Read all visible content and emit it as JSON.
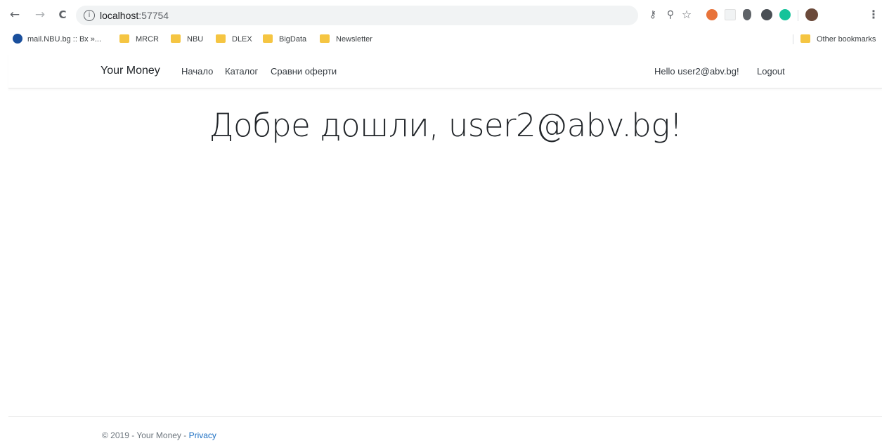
{
  "browser": {
    "url_host": "localhost",
    "url_port": ":57754",
    "back_icon": "←",
    "forward_icon": "→",
    "reload_icon": "C",
    "info_icon": "i",
    "key_icon": "⚷",
    "zoom_icon": "⚲",
    "star_icon": "☆",
    "menu_icon": "⋮",
    "colors": {
      "ext_red": "#e8733a",
      "ext_green": "#15c39a",
      "ext_dark": "#4a4f55"
    }
  },
  "bookmarks": {
    "items": [
      "mail.NBU.bg :: Вх »...",
      "MRCR",
      "NBU",
      "DLEX",
      "BigData",
      "Newsletter"
    ],
    "other": "Other bookmarks"
  },
  "navbar": {
    "brand": "Your Money",
    "links": [
      "Начало",
      "Каталог",
      "Сравни оферти"
    ],
    "hello": "Hello user2@abv.bg!",
    "logout": "Logout"
  },
  "main": {
    "welcome": "Добре дошли, user2@abv.bg!"
  },
  "footer": {
    "text": "© 2019 - Your Money - ",
    "privacy": "Privacy"
  }
}
